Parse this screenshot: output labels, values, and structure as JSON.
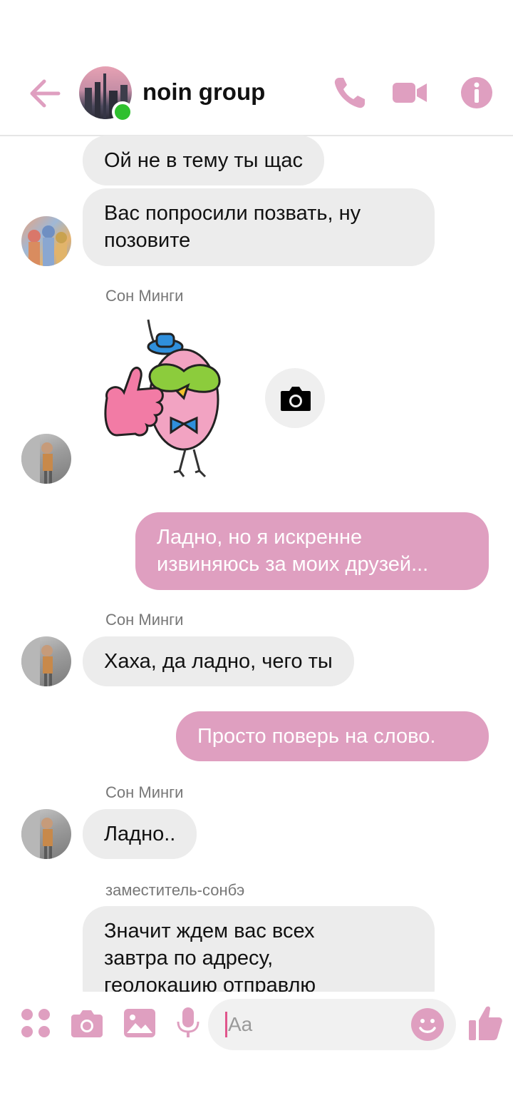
{
  "header": {
    "title": "noin group",
    "back_icon": "arrow-left-icon",
    "call_icon": "phone-icon",
    "video_icon": "video-camera-icon",
    "info_icon": "info-icon",
    "accent": "#df9fc0",
    "online": true
  },
  "messages": [
    {
      "id": "m1",
      "direction": "in",
      "text": "Ой не в тему ты щас"
    },
    {
      "id": "m2",
      "direction": "in",
      "line1": "Вас попросили позвать, ну",
      "line2": "позовите"
    },
    {
      "id": "m3",
      "direction": "in",
      "sender": "Сон Минги",
      "type": "sticker",
      "sticker_icon": "pink-bird-thumbs-up-sticker"
    },
    {
      "id": "m4",
      "direction": "out",
      "line1": "Ладно, но я искренне",
      "line2": "извиняюсь за моих друзей..."
    },
    {
      "id": "m5",
      "direction": "in",
      "sender": "Сон Минги",
      "text": "Хаха, да ладно, чего ты"
    },
    {
      "id": "m6",
      "direction": "out",
      "text": "Просто поверь на слово."
    },
    {
      "id": "m7",
      "direction": "in",
      "sender": "Сон Минги",
      "text": "Ладно.."
    },
    {
      "id": "m8",
      "direction": "in",
      "sender": "заместитель-сонбэ",
      "line1": "Значит ждем вас всех",
      "line2": "завтра по адресу,",
      "line3": "геолокацию отправлю"
    }
  ],
  "composer": {
    "placeholder": "Aa",
    "icons": [
      "apps-icon",
      "camera-icon",
      "image-icon",
      "microphone-icon",
      "emoji-icon",
      "thumbs-up-icon"
    ]
  }
}
